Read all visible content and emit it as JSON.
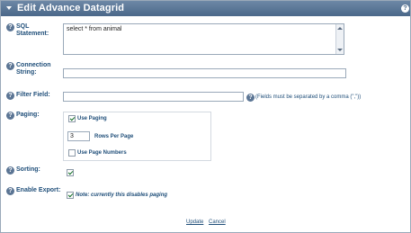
{
  "header": {
    "title": "Edit Advance Datagrid",
    "help_glyph": "?"
  },
  "form": {
    "sql": {
      "label": "SQL Statement:",
      "value": "select * from animal"
    },
    "connection": {
      "label": "Connection String:",
      "value": ""
    },
    "filter": {
      "label": "Filter Field:",
      "value": "",
      "hint": "(Fields must be separated by a comma (\",\"))"
    },
    "paging": {
      "label": "Paging:",
      "use_paging_label": "Use Paging",
      "use_paging_checked": true,
      "rows_value": "3",
      "rows_label": "Rows Per Page",
      "page_numbers_label": "Use Page Numbers",
      "page_numbers_checked": false
    },
    "sorting": {
      "label": "Sorting:",
      "checked": true
    },
    "export": {
      "label": "Enable Export:",
      "checked": true,
      "note": "Note: currently this disables paging"
    }
  },
  "actions": {
    "update": "Update",
    "cancel": "Cancel"
  },
  "colors": {
    "title_bar": "#4a6789",
    "label_text": "#1f4e79",
    "border": "#9aa9b9"
  }
}
